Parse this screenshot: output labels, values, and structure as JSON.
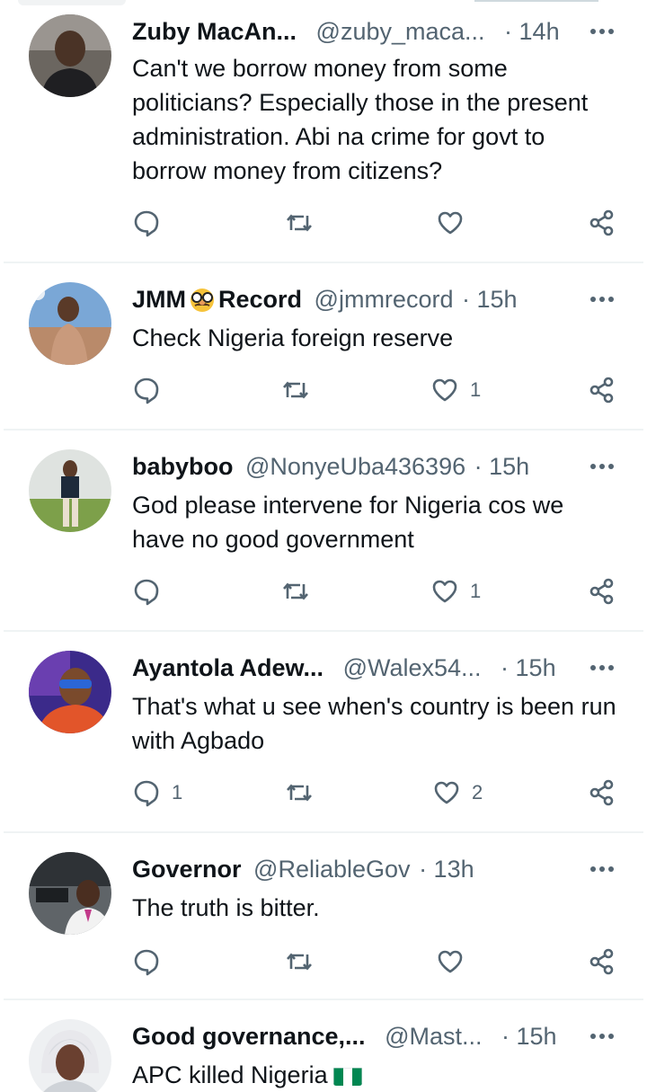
{
  "replies": [
    {
      "name": "Zuby MacAn...",
      "handle": "@zuby_maca...",
      "time": "· 14h",
      "text": "Can't we borrow money from some politicians? Especially those in the present administration. Abi na crime for govt to borrow money from citizens?",
      "replies_count": "",
      "reposts_count": "",
      "likes_count": ""
    },
    {
      "name_part1": "JMM",
      "name_part2": "Record",
      "name_emoji": "disguised-face-emoji",
      "handle": "@jmmrecord",
      "time": "· 15h",
      "text": "Check Nigeria foreign reserve",
      "replies_count": "",
      "reposts_count": "",
      "likes_count": "1"
    },
    {
      "name": "babyboo",
      "handle": "@NonyeUba436396",
      "time": "· 15h",
      "text": "God please intervene for Nigeria cos we have no good government",
      "replies_count": "",
      "reposts_count": "",
      "likes_count": "1"
    },
    {
      "name": "Ayantola Adew...",
      "handle": "@Walex54...",
      "time": "· 15h",
      "text": "That's what u see when's country is been run with Agbado",
      "replies_count": "1",
      "reposts_count": "",
      "likes_count": "2"
    },
    {
      "name": "Governor",
      "handle": "@ReliableGov",
      "time": "· 13h",
      "text": "The truth is bitter.",
      "replies_count": "",
      "reposts_count": "",
      "likes_count": ""
    },
    {
      "name": "Good governance,...",
      "handle": "@Mast...",
      "time": "· 15h",
      "text": "APC killed Nigeria",
      "text_emoji": "nigeria-flag-emoji",
      "replies_count": "",
      "reposts_count": "",
      "likes_count": ""
    }
  ],
  "icons": {
    "reply": "speech-bubble-icon",
    "repost": "repost-arrows-icon",
    "like": "heart-icon",
    "share": "share-icon",
    "more": "more-dots-icon"
  },
  "colors": {
    "text": "#0f1419",
    "secondary": "#536471",
    "divider": "#eff3f4",
    "flag_green": "#008751"
  }
}
